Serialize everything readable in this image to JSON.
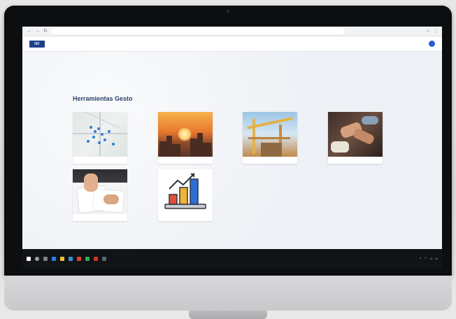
{
  "browser": {
    "url": "",
    "nav_back": "←",
    "nav_forward": "→",
    "reload": "↻"
  },
  "site": {
    "logo_text": "IEI",
    "menu": [
      "",
      "",
      "",
      "",
      "",
      "",
      ""
    ]
  },
  "page": {
    "title": "Herramientas Gesto"
  },
  "tiles": [
    {
      "caption": "",
      "icon": "map-thumbnail"
    },
    {
      "caption": "",
      "icon": "city-sunset-thumbnail"
    },
    {
      "caption": "",
      "icon": "construction-thumbnail"
    },
    {
      "caption": "",
      "icon": "handshake-thumbnail"
    },
    {
      "caption": "",
      "icon": "documents-thumbnail"
    },
    {
      "caption": "",
      "icon": "bar-chart-growth-icon"
    }
  ],
  "colors": {
    "brand": "#1f3f8a",
    "title": "#2d3f6b",
    "taskbar": "#111316"
  }
}
